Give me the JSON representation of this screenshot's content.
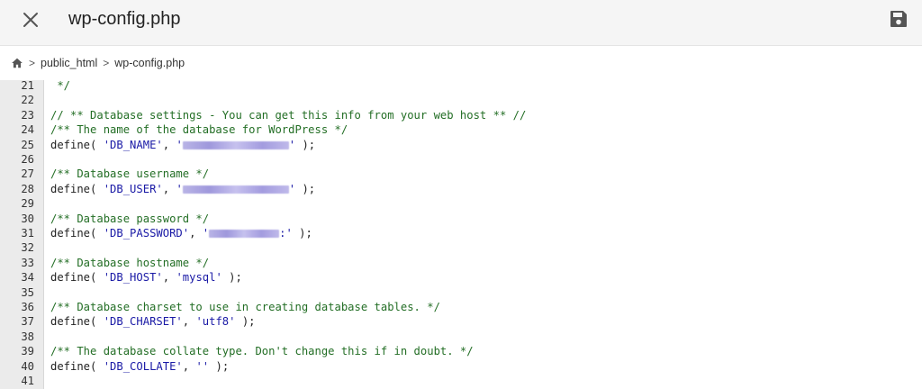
{
  "window": {
    "title": "wp-config.php",
    "close_icon": "close-icon",
    "save_icon": "save-icon"
  },
  "breadcrumb": {
    "home_icon": "home-icon",
    "items": [
      "public_html",
      "wp-config.php"
    ],
    "separator": ">"
  },
  "editor": {
    "lines": [
      {
        "n": "21",
        "text": " */"
      },
      {
        "n": "22",
        "text": ""
      },
      {
        "n": "23",
        "text": "// ** Database settings - You can get this info from your web host ** //"
      },
      {
        "n": "24",
        "text": "/** The name of the database for WordPress */"
      },
      {
        "n": "25",
        "define": "define(",
        "key": "'DB_NAME'",
        "sep": ", ",
        "val_open": "'",
        "val_close": "'",
        "end": " );"
      },
      {
        "n": "26",
        "text": ""
      },
      {
        "n": "27",
        "text": "/** Database username */"
      },
      {
        "n": "28",
        "define": "define(",
        "key": "'DB_USER'",
        "sep": ", ",
        "val_open": "'",
        "val_close": "'",
        "end": " );"
      },
      {
        "n": "29",
        "text": ""
      },
      {
        "n": "30",
        "text": "/** Database password */"
      },
      {
        "n": "31",
        "define": "define(",
        "key": "'DB_PASSWORD'",
        "sep": ", ",
        "val_open": "'",
        "val_close": ":'",
        "end": " );"
      },
      {
        "n": "32",
        "text": ""
      },
      {
        "n": "33",
        "text": "/** Database hostname */"
      },
      {
        "n": "34",
        "define": "define(",
        "key": "'DB_HOST'",
        "sep": ", ",
        "value": "'mysql'",
        "end": " );"
      },
      {
        "n": "35",
        "text": ""
      },
      {
        "n": "36",
        "text": "/** Database charset to use in creating database tables. */"
      },
      {
        "n": "37",
        "define": "define(",
        "key": "'DB_CHARSET'",
        "sep": ", ",
        "value": "'utf8'",
        "end": " );"
      },
      {
        "n": "38",
        "text": ""
      },
      {
        "n": "39",
        "text": "/** The database collate type. Don't change this if in doubt. */"
      },
      {
        "n": "40",
        "define": "define(",
        "key": "'DB_COLLATE'",
        "sep": ", ",
        "value": "''",
        "end": " );"
      },
      {
        "n": "41",
        "text": ""
      }
    ]
  },
  "colors": {
    "comment": "#236e25",
    "string": "#1a1aa6",
    "gutter_bg": "#ebebeb",
    "topbar_bg": "#f5f5f5"
  }
}
